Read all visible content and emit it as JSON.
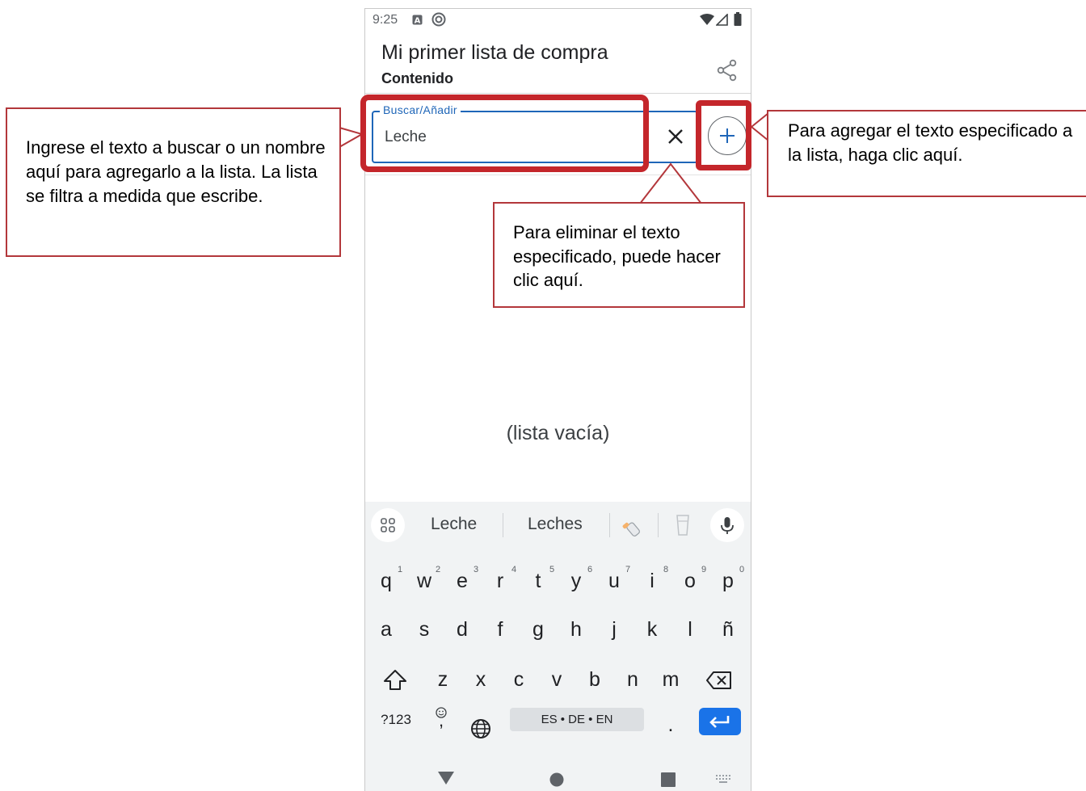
{
  "status_bar": {
    "time": "9:25"
  },
  "app_bar": {
    "title": "Mi primer lista de compra",
    "subtitle": "Contenido"
  },
  "search": {
    "label": "Buscar/Añadir",
    "value": "Leche"
  },
  "list": {
    "empty_text": "(lista vacía)"
  },
  "keyboard": {
    "suggestions": [
      "Leche",
      "Leches"
    ],
    "row1": [
      "q",
      "w",
      "e",
      "r",
      "t",
      "y",
      "u",
      "i",
      "o",
      "p"
    ],
    "row1_hints": [
      "1",
      "2",
      "3",
      "4",
      "5",
      "6",
      "7",
      "8",
      "9",
      "0"
    ],
    "row2": [
      "a",
      "s",
      "d",
      "f",
      "g",
      "h",
      "j",
      "k",
      "l",
      "ñ"
    ],
    "row3": [
      "z",
      "x",
      "c",
      "v",
      "b",
      "n",
      "m"
    ],
    "symbols_key": "?123",
    "comma_key": ",",
    "period_key": ".",
    "language_key": "ES • DE • EN"
  },
  "callouts": {
    "search": "Ingrese el texto a buscar o un nombre aquí para agregarlo a la lista. La lista se filtra a medida que escribe.",
    "clear": "Para eliminar el texto especificado, puede hacer clic aquí.",
    "add": "Para agregar el texto especificado a la lista, haga clic aquí."
  },
  "colors": {
    "accent": "#1f66b8",
    "highlight": "#c4262b",
    "callout_border": "#b3373b",
    "enter_key": "#1a73e8"
  },
  "icons": [
    "lock-notification-icon",
    "sync-notification-icon",
    "wifi-icon",
    "signal-icon",
    "battery-icon",
    "share-icon",
    "close-icon",
    "plus-icon",
    "apps-grid-icon",
    "baby-bottle-emoji-icon",
    "glass-emoji-icon",
    "microphone-icon",
    "shift-icon",
    "backspace-icon",
    "emoji-icon",
    "globe-icon",
    "enter-icon",
    "back-triangle-icon",
    "home-circle-icon",
    "recents-square-icon",
    "keyboard-switch-icon"
  ]
}
